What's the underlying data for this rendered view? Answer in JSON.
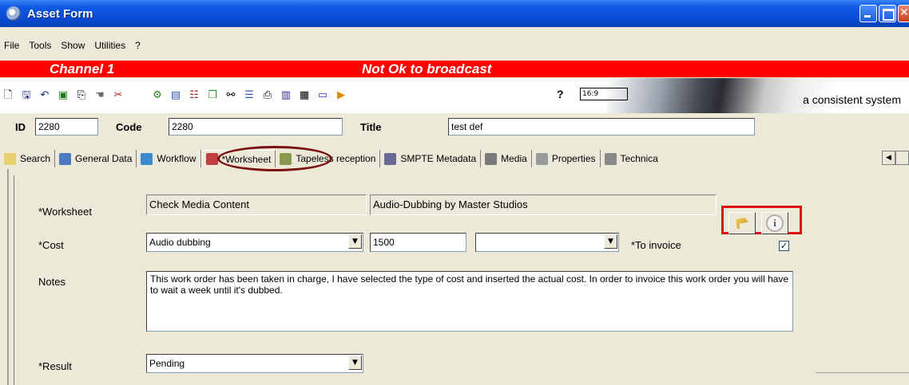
{
  "window": {
    "title": "Asset Form"
  },
  "menu": [
    {
      "label": "File"
    },
    {
      "label": "Tools"
    },
    {
      "label": "Show"
    },
    {
      "label": "Utilities"
    },
    {
      "label": "?"
    }
  ],
  "banner": {
    "channel": "Channel 1",
    "status": "Not Ok to broadcast",
    "color": "#ff0000"
  },
  "toolbar": {
    "left_icons": [
      "new-icon",
      "save-icon",
      "undo-icon",
      "refresh-icon",
      "copy-icon",
      "hand-icon",
      "tools-icon"
    ],
    "mid_icons": [
      "workflow-icon",
      "film-icon",
      "schedule-icon",
      "copy-doc-icon",
      "binoculars-icon",
      "network-icon",
      "preview-icon",
      "book-icon",
      "clapper-icon",
      "monitor-icon",
      "play-icon"
    ],
    "help_label": "?",
    "ratio_label": "16:9",
    "slogan": "a consistent system"
  },
  "header_fields": {
    "id_label": "ID",
    "id_value": "2280",
    "code_label": "Code",
    "code_value": "2280",
    "title_label": "Title",
    "title_value": "test def"
  },
  "tabs": [
    {
      "label": "Search"
    },
    {
      "label": "General Data"
    },
    {
      "label": "Workflow"
    },
    {
      "label": "*Worksheet",
      "active": true
    },
    {
      "label": "Tapeless reception"
    },
    {
      "label": "SMPTE Metadata"
    },
    {
      "label": "Media"
    },
    {
      "label": "Properties"
    },
    {
      "label": "Technica"
    }
  ],
  "form": {
    "worksheet_label": "*Worksheet",
    "worksheet_value": "Check Media Content",
    "worksheet_vendor": "Audio-Dubbing by Master Studios",
    "cost_label": "*Cost",
    "cost_type": "Audio dubbing",
    "cost_amount": "1500",
    "cost_extra": "",
    "invoice_label": "*To invoice",
    "invoice_checked": true,
    "notes_label": "Notes",
    "notes_text": "This work order has been taken in charge, I have selected the type of cost and inserted the actual cost. In order to invoice this work order you will have to wait a week until it's dubbed.",
    "result_label": "*Result",
    "result_value": "Pending"
  },
  "colors": {
    "highlight_box": "#e01010",
    "workflow_ellipse": "#7a1010",
    "titlebar": "#0a4bd2"
  }
}
